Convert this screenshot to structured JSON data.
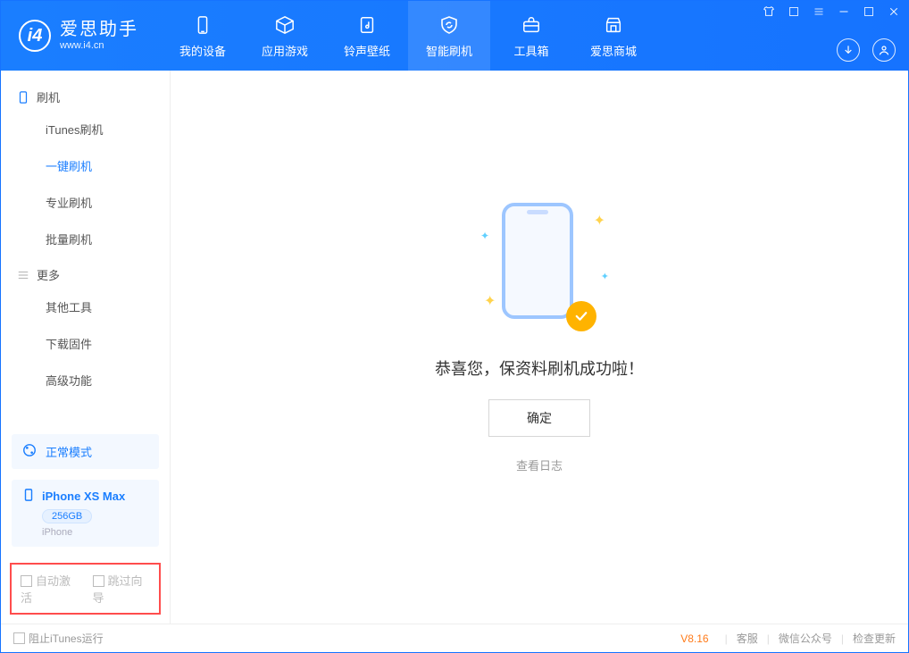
{
  "app": {
    "name_cn": "爱思助手",
    "url": "www.i4.cn"
  },
  "nav": {
    "items": [
      {
        "label": "我的设备",
        "icon": "phone-icon"
      },
      {
        "label": "应用游戏",
        "icon": "cube-icon"
      },
      {
        "label": "铃声壁纸",
        "icon": "music-doc-icon"
      },
      {
        "label": "智能刷机",
        "icon": "shield-refresh-icon",
        "active": true
      },
      {
        "label": "工具箱",
        "icon": "toolbox-icon"
      },
      {
        "label": "爱思商城",
        "icon": "store-icon"
      }
    ]
  },
  "sidebar": {
    "sections": [
      {
        "title": "刷机",
        "icon": "device-icon",
        "items": [
          "iTunes刷机",
          "一键刷机",
          "专业刷机",
          "批量刷机"
        ],
        "activeIndex": 1
      },
      {
        "title": "更多",
        "icon": "list-icon",
        "items": [
          "其他工具",
          "下载固件",
          "高级功能"
        ]
      }
    ],
    "mode": {
      "label": "正常模式"
    },
    "device": {
      "name": "iPhone XS Max",
      "storage": "256GB",
      "type": "iPhone"
    },
    "checkboxes": {
      "auto_activate": {
        "label": "自动激活",
        "checked": false
      },
      "skip_guide": {
        "label": "跳过向导",
        "checked": false
      }
    }
  },
  "content": {
    "success_text": "恭喜您，保资料刷机成功啦！",
    "ok_button": "确定",
    "view_log": "查看日志"
  },
  "footer": {
    "block_itunes": {
      "label": "阻止iTunes运行",
      "checked": false
    },
    "version": "V8.16",
    "links": [
      "客服",
      "微信公众号",
      "检查更新"
    ]
  }
}
